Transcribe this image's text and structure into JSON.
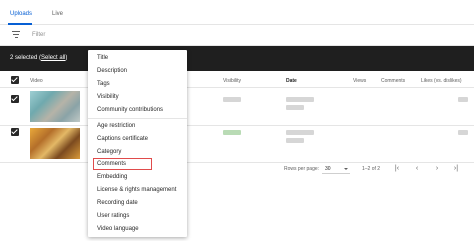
{
  "tabs": {
    "uploads": "Uploads",
    "live": "Live"
  },
  "filter": {
    "placeholder": "Filter"
  },
  "selection": {
    "count_text": "2 selected (",
    "select_all": "Select all",
    "close": ")"
  },
  "table": {
    "headers": {
      "video": "Video",
      "visibility": "Visibility",
      "date": "Date",
      "views": "Views",
      "comments": "Comments",
      "likes": "Likes (vs. dislikes)"
    }
  },
  "footer": {
    "rows_per_page_label": "Rows per page:",
    "rows_per_page_value": "30",
    "range": "1–2 of 2",
    "first_icon": "first-page-icon",
    "prev_icon": "prev-page-icon",
    "next_icon": "next-page-icon",
    "last_icon": "last-page-icon"
  },
  "menu": {
    "items_group1": [
      "Title",
      "Description",
      "Tags",
      "Visibility",
      "Community contributions"
    ],
    "items_group2": [
      "Age restriction",
      "Captions certificate",
      "Category",
      "Comments",
      "Embedding",
      "License & rights management",
      "Recording date",
      "User ratings",
      "Video language"
    ],
    "highlighted": "Comments"
  },
  "colors": {
    "accent": "#065fd4",
    "selection_bar": "#1f1f1f",
    "highlight": "#e04b4b"
  }
}
